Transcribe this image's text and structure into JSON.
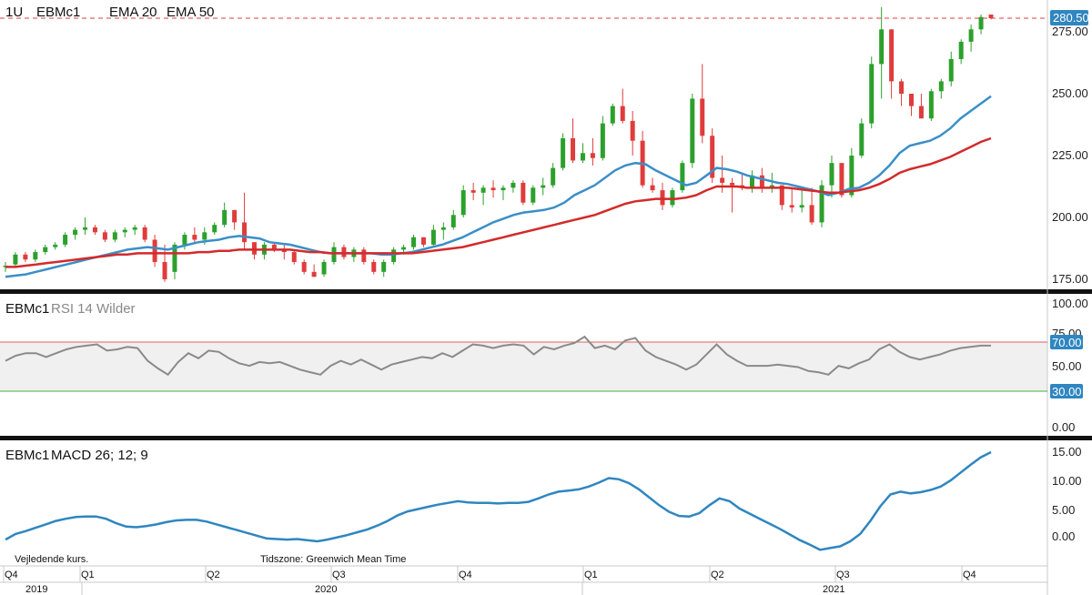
{
  "header": {
    "interval": "1U",
    "symbol": "EBMc1",
    "ema20_label": "EMA 20",
    "ema50_label": "EMA 50"
  },
  "price_panel": {
    "last_price": "280.50",
    "y_ticks": [
      "275.00",
      "250.00",
      "225.00",
      "200.00",
      "175.00"
    ]
  },
  "rsi_panel": {
    "symbol": "EBMc1",
    "label": "RSI 14 Wilder",
    "y_ticks": [
      "100.00",
      "75.00",
      "50.00",
      "0.00"
    ],
    "upper_label": "70.00",
    "lower_label": "30.00"
  },
  "macd_panel": {
    "symbol": "EBMc1",
    "label": "MACD 26; 12; 9",
    "y_ticks": [
      "15.00",
      "10.00",
      "5.00",
      "0.00"
    ]
  },
  "footer": {
    "note_left": "Vejledende kurs.",
    "note_tz": "Tidszone: Greenwich Mean Time",
    "quarters": [
      "Q4",
      "Q1",
      "Q2",
      "Q3",
      "Q4",
      "Q1",
      "Q2",
      "Q3",
      "Q4"
    ],
    "years": [
      "2019",
      "2020",
      "2021"
    ]
  },
  "colors": {
    "up": "#2ca02c",
    "down": "#e03c3c",
    "ema20": "#3a8fc8",
    "ema50": "#d42a2a",
    "rsi": "#8a8a8a",
    "macd": "#2f86c0",
    "badge": "#2f86c0"
  },
  "chart_data": [
    {
      "type": "candlestick",
      "title": "EBMc1",
      "ylim": [
        168,
        285
      ],
      "candles": [
        [
          180,
          182,
          178,
          180.5
        ],
        [
          181,
          186,
          180,
          185
        ],
        [
          185,
          186,
          182,
          183
        ],
        [
          183,
          187,
          182,
          186
        ],
        [
          186,
          189,
          185,
          188
        ],
        [
          188,
          190,
          187,
          189
        ],
        [
          189,
          194,
          188,
          193
        ],
        [
          193,
          196,
          191,
          195
        ],
        [
          195,
          200,
          193,
          196
        ],
        [
          196,
          197,
          193,
          194
        ],
        [
          194,
          195,
          190,
          191
        ],
        [
          191,
          195,
          190,
          194
        ],
        [
          194,
          196,
          192,
          195
        ],
        [
          195,
          197,
          193,
          196
        ],
        [
          196,
          197,
          190,
          191
        ],
        [
          191,
          193,
          180,
          182
        ],
        [
          182,
          189,
          174,
          175
        ],
        [
          178,
          190,
          175,
          189
        ],
        [
          189,
          194,
          187,
          193
        ],
        [
          193,
          196,
          190,
          191
        ],
        [
          191,
          196,
          189,
          194
        ],
        [
          194,
          198,
          193,
          197
        ],
        [
          197,
          206,
          196,
          203
        ],
        [
          203,
          201,
          195,
          198
        ],
        [
          198,
          210,
          187,
          190
        ],
        [
          190,
          190,
          183,
          185
        ],
        [
          185,
          190,
          183,
          189
        ],
        [
          189,
          190,
          186,
          187
        ],
        [
          187,
          189,
          183,
          186
        ],
        [
          186,
          187,
          181,
          182
        ],
        [
          182,
          183,
          177,
          178
        ],
        [
          178,
          181,
          176,
          176
        ],
        [
          177,
          183,
          176,
          182
        ],
        [
          182,
          190,
          181,
          188
        ],
        [
          188,
          189,
          183,
          184
        ],
        [
          184,
          188,
          182,
          187
        ],
        [
          187,
          188,
          181,
          182
        ],
        [
          182,
          183,
          177,
          178
        ],
        [
          178,
          183,
          176,
          182
        ],
        [
          182,
          188,
          181,
          187
        ],
        [
          187,
          189,
          185,
          188
        ],
        [
          188,
          193,
          187,
          192
        ],
        [
          192,
          192,
          188,
          189
        ],
        [
          189,
          197,
          188,
          195
        ],
        [
          195,
          198,
          191,
          196
        ],
        [
          196,
          203,
          195,
          201
        ],
        [
          201,
          213,
          200,
          211
        ],
        [
          211,
          214,
          207,
          210
        ],
        [
          210,
          213,
          205,
          212
        ],
        [
          212,
          215,
          208,
          211
        ],
        [
          211,
          213,
          207,
          212
        ],
        [
          212,
          215,
          210,
          214
        ],
        [
          214,
          215,
          205,
          206
        ],
        [
          206,
          213,
          205,
          212
        ],
        [
          212,
          216,
          209,
          213
        ],
        [
          213,
          222,
          212,
          220
        ],
        [
          220,
          234,
          219,
          232
        ],
        [
          232,
          240,
          222,
          223
        ],
        [
          223,
          230,
          222,
          226
        ],
        [
          226,
          232,
          221,
          224
        ],
        [
          224,
          241,
          223,
          238
        ],
        [
          238,
          246,
          237,
          245
        ],
        [
          245,
          252,
          238,
          239
        ],
        [
          239,
          243,
          225,
          231
        ],
        [
          231,
          235,
          212,
          213
        ],
        [
          213,
          216,
          210,
          211
        ],
        [
          211,
          214,
          203,
          205
        ],
        [
          205,
          212,
          204,
          211
        ],
        [
          211,
          223,
          210,
          222
        ],
        [
          222,
          250,
          220,
          248
        ],
        [
          248,
          262,
          230,
          233
        ],
        [
          233,
          236,
          214,
          216
        ],
        [
          216,
          225,
          210,
          214
        ],
        [
          214,
          216,
          202,
          213
        ],
        [
          213,
          218,
          211,
          212
        ],
        [
          212,
          219,
          210,
          217
        ],
        [
          217,
          220,
          210,
          212
        ],
        [
          212,
          218,
          210,
          213
        ],
        [
          213,
          213,
          203,
          205
        ],
        [
          205,
          212,
          202,
          204
        ],
        [
          204,
          211,
          202,
          205
        ],
        [
          205,
          212,
          197,
          198
        ],
        [
          198,
          215,
          196,
          213
        ],
        [
          213,
          225,
          208,
          222
        ],
        [
          222,
          215,
          208,
          209
        ],
        [
          209,
          228,
          208,
          225
        ],
        [
          225,
          240,
          224,
          238
        ],
        [
          238,
          265,
          236,
          262
        ],
        [
          262,
          285,
          248,
          276
        ],
        [
          276,
          271,
          248,
          255
        ],
        [
          255,
          256,
          245,
          250
        ],
        [
          250,
          249,
          241,
          245
        ],
        [
          245,
          250,
          240,
          240
        ],
        [
          240,
          252,
          239,
          251
        ],
        [
          251,
          256,
          248,
          255
        ],
        [
          255,
          267,
          253,
          264
        ],
        [
          264,
          272,
          262,
          271
        ],
        [
          271,
          278,
          267,
          276
        ],
        [
          276,
          282,
          274,
          281
        ],
        [
          282,
          282,
          280,
          280.5
        ]
      ],
      "series": [
        {
          "name": "EMA 20",
          "values": [
            176,
            176.5,
            177,
            178,
            179,
            180,
            181,
            182,
            183,
            184,
            185,
            186,
            187,
            187.5,
            188,
            187.5,
            187,
            188,
            189,
            190,
            190.5,
            191,
            192,
            192.5,
            192,
            191.5,
            190,
            189.5,
            189,
            188,
            187,
            186,
            185.5,
            185.5,
            185.5,
            185.5,
            185.5,
            185,
            185,
            185.5,
            186,
            187,
            188,
            189,
            190.5,
            192,
            194,
            196,
            198,
            199.5,
            201,
            202,
            202.5,
            203,
            204,
            206,
            209,
            211,
            213,
            216,
            219,
            221,
            222,
            221.5,
            219,
            217,
            215,
            213,
            214,
            217,
            220,
            219.5,
            218.5,
            217,
            216,
            215,
            214,
            213.5,
            212.5,
            211.5,
            210.5,
            209,
            210,
            211.5,
            212,
            214,
            217,
            221,
            226,
            229,
            230,
            231,
            233,
            236,
            240,
            243,
            246,
            249
          ]
        },
        {
          "name": "EMA 50",
          "values": [
            180,
            180,
            180.5,
            181,
            181.5,
            182,
            182.5,
            183,
            183.5,
            184,
            184.5,
            185,
            185,
            185.5,
            185.5,
            185.5,
            185.5,
            185.5,
            185.5,
            186,
            186,
            186.5,
            186.5,
            187,
            187,
            187,
            187,
            187,
            187,
            186.5,
            186,
            186,
            185.5,
            185.5,
            185.5,
            185.5,
            185.5,
            185.5,
            185.5,
            185.5,
            185.5,
            186,
            186.5,
            187,
            187.5,
            188,
            189,
            190,
            191,
            192,
            193,
            194,
            195,
            196,
            197,
            198,
            199,
            200,
            201,
            202.5,
            204,
            205.5,
            206.5,
            207,
            207.5,
            207.5,
            207.5,
            208,
            209,
            211,
            212.5,
            212.5,
            212.5,
            212,
            212,
            212,
            212,
            212,
            211.5,
            211,
            210.5,
            210,
            210,
            210.5,
            211,
            212,
            213.5,
            215.5,
            218,
            219.5,
            220.5,
            221.5,
            223,
            224.5,
            226.5,
            228.5,
            230.5,
            232
          ]
        }
      ]
    },
    {
      "type": "line",
      "title": "RSI 14 Wilder",
      "ylim": [
        0,
        100
      ],
      "reference_lines": [
        70,
        30
      ],
      "series": [
        {
          "name": "RSI 14 Wilder",
          "values": [
            55,
            59,
            61,
            61,
            58,
            61,
            64,
            66,
            67,
            68,
            63,
            64,
            66,
            65,
            55,
            49,
            44,
            54,
            61,
            57,
            63,
            62,
            57,
            53,
            51,
            54,
            53,
            54,
            51,
            48,
            46,
            44,
            51,
            55,
            52,
            56,
            52,
            48,
            52,
            54,
            56,
            58,
            57,
            61,
            58,
            63,
            68,
            67,
            65,
            67,
            68,
            67,
            60,
            66,
            64,
            67,
            69,
            74,
            65,
            67,
            64,
            71,
            73,
            63,
            58,
            55,
            52,
            48,
            52,
            60,
            68,
            60,
            55,
            51,
            51,
            51,
            52,
            51,
            50,
            47,
            46,
            44,
            51,
            49,
            53,
            56,
            64,
            68,
            62,
            58,
            56,
            58,
            60,
            63,
            65,
            66,
            67,
            67
          ]
        }
      ]
    },
    {
      "type": "line",
      "title": "MACD 26; 12; 9",
      "ylim": [
        -3,
        16
      ],
      "series": [
        {
          "name": "MACD 26; 12; 9",
          "values": [
            -0.5,
            0.5,
            1.0,
            1.6,
            2.2,
            2.8,
            3.2,
            3.5,
            3.6,
            3.6,
            3.2,
            2.4,
            1.8,
            1.7,
            1.9,
            2.2,
            2.6,
            2.9,
            3.0,
            3.0,
            2.7,
            2.2,
            1.7,
            1.2,
            0.7,
            0.2,
            -0.3,
            -0.4,
            -0.5,
            -0.4,
            -0.6,
            -0.8,
            -0.5,
            -0.1,
            0.3,
            0.8,
            1.3,
            2.0,
            2.8,
            3.8,
            4.5,
            4.9,
            5.3,
            5.7,
            6.0,
            6.3,
            6.1,
            6.0,
            6.0,
            5.9,
            6.0,
            6.0,
            6.2,
            6.8,
            7.5,
            8.0,
            8.2,
            8.4,
            8.9,
            9.6,
            10.4,
            10.2,
            9.5,
            8.4,
            7.0,
            5.6,
            4.4,
            3.7,
            3.6,
            4.2,
            5.6,
            6.8,
            6.3,
            5.0,
            4.1,
            3.2,
            2.3,
            1.4,
            0.4,
            -0.6,
            -1.4,
            -2.3,
            -2.0,
            -1.7,
            -0.8,
            0.5,
            2.8,
            5.4,
            7.5,
            8.0,
            7.7,
            7.9,
            8.3,
            8.9,
            10.0,
            11.4,
            12.8,
            14.1,
            15.0
          ]
        }
      ]
    }
  ]
}
